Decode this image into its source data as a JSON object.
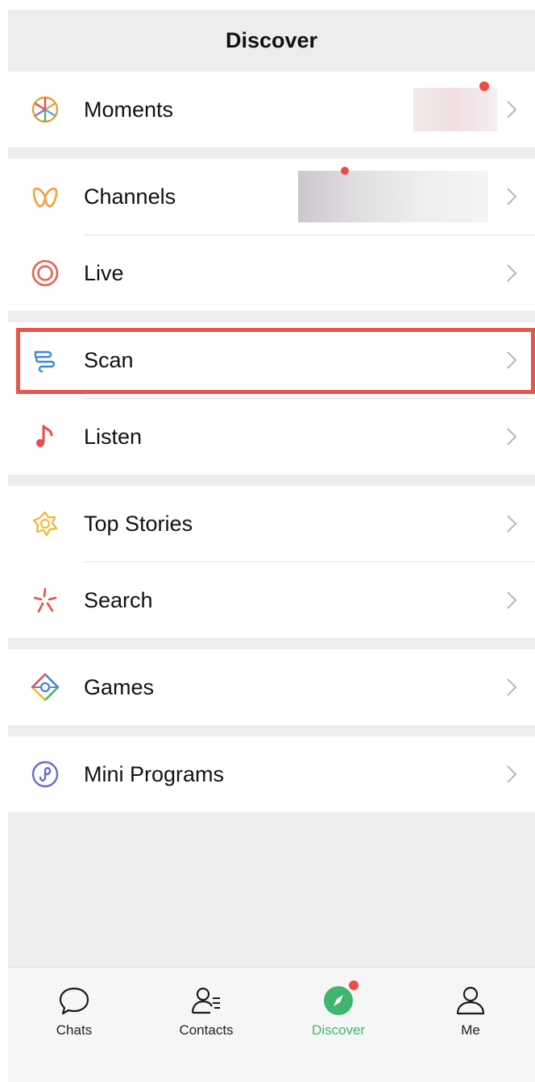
{
  "header": {
    "title": "Discover"
  },
  "groups": [
    {
      "items": [
        {
          "label": "Moments",
          "icon": "moments-icon"
        }
      ]
    },
    {
      "items": [
        {
          "label": "Channels",
          "icon": "channels-icon"
        },
        {
          "label": "Live",
          "icon": "live-icon"
        }
      ]
    },
    {
      "items": [
        {
          "label": "Scan",
          "icon": "scan-icon"
        },
        {
          "label": "Listen",
          "icon": "listen-icon"
        }
      ]
    },
    {
      "items": [
        {
          "label": "Top Stories",
          "icon": "top-stories-icon"
        },
        {
          "label": "Search",
          "icon": "search-icon"
        }
      ]
    },
    {
      "items": [
        {
          "label": "Games",
          "icon": "games-icon"
        }
      ]
    },
    {
      "items": [
        {
          "label": "Mini Programs",
          "icon": "mini-programs-icon"
        }
      ]
    }
  ],
  "highlighted_item": "Scan",
  "tabbar": {
    "tabs": [
      {
        "label": "Chats",
        "icon": "chat-bubble-icon"
      },
      {
        "label": "Contacts",
        "icon": "contacts-icon"
      },
      {
        "label": "Discover",
        "icon": "compass-icon",
        "active": true
      },
      {
        "label": "Me",
        "icon": "person-icon"
      }
    ]
  },
  "colors": {
    "accent_green": "#3fb56e",
    "badge_red": "#f04b40",
    "highlight_border": "#e8554a",
    "background": "#ededed"
  }
}
